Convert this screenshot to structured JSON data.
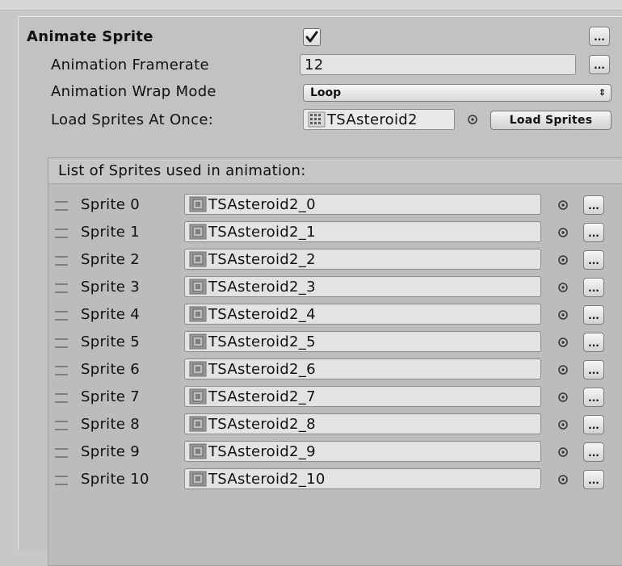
{
  "animate_sprite": {
    "title": "Animate Sprite",
    "checked": true
  },
  "framerate": {
    "label": "Animation Framerate",
    "value": "12"
  },
  "wrap_mode": {
    "label": "Animation Wrap Mode",
    "value": "Loop",
    "arrows": "⇕"
  },
  "load_sprites": {
    "label": "Load Sprites At Once:",
    "asset": "TSAsteroid2",
    "button": "Load Sprites"
  },
  "more_button_label": "...",
  "sprite_list": {
    "header": "List of Sprites used in animation:",
    "items": [
      {
        "label": "Sprite 0",
        "value": "TSAsteroid2_0"
      },
      {
        "label": "Sprite 1",
        "value": "TSAsteroid2_1"
      },
      {
        "label": "Sprite 2",
        "value": "TSAsteroid2_2"
      },
      {
        "label": "Sprite 3",
        "value": "TSAsteroid2_3"
      },
      {
        "label": "Sprite 4",
        "value": "TSAsteroid2_4"
      },
      {
        "label": "Sprite 5",
        "value": "TSAsteroid2_5"
      },
      {
        "label": "Sprite 6",
        "value": "TSAsteroid2_6"
      },
      {
        "label": "Sprite 7",
        "value": "TSAsteroid2_7"
      },
      {
        "label": "Sprite 8",
        "value": "TSAsteroid2_8"
      },
      {
        "label": "Sprite 9",
        "value": "TSAsteroid2_9"
      },
      {
        "label": "Sprite 10",
        "value": "TSAsteroid2_10"
      }
    ]
  },
  "icons": {
    "drag_handle": "drag-handle-icon",
    "object_picker": "object-picker-icon",
    "sprite_thumbnail": "sprite-thumbnail-icon",
    "checkmark": "checkmark-icon"
  }
}
